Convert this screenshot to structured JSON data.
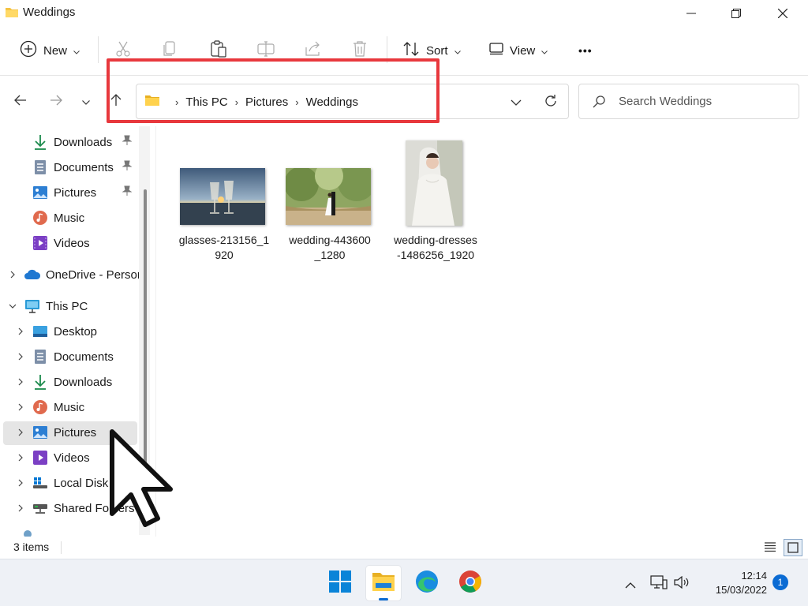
{
  "window": {
    "title": "Weddings"
  },
  "toolbar": {
    "new_label": "New",
    "sort_label": "Sort",
    "view_label": "View",
    "more_label": "•••"
  },
  "address": {
    "crumbs": [
      "This PC",
      "Pictures",
      "Weddings"
    ]
  },
  "search": {
    "placeholder": "Search Weddings"
  },
  "sidebar": {
    "quick_access": [
      {
        "label": "Downloads",
        "icon": "download-icon",
        "pinned": true
      },
      {
        "label": "Documents",
        "icon": "document-icon",
        "pinned": true
      },
      {
        "label": "Pictures",
        "icon": "picture-icon",
        "pinned": true
      },
      {
        "label": "Music",
        "icon": "music-icon",
        "pinned": false
      },
      {
        "label": "Videos",
        "icon": "video-icon",
        "pinned": false
      }
    ],
    "onedrive": "OneDrive - Person",
    "this_pc": "This PC",
    "pc_items": [
      {
        "label": "Desktop",
        "icon": "desktop-icon"
      },
      {
        "label": "Documents",
        "icon": "document-icon"
      },
      {
        "label": "Downloads",
        "icon": "download-icon"
      },
      {
        "label": "Music",
        "icon": "music-icon"
      },
      {
        "label": "Pictures",
        "icon": "picture-icon",
        "selected": true
      },
      {
        "label": "Videos",
        "icon": "video-icon"
      },
      {
        "label": "Local Disk (",
        "icon": "disk-icon"
      },
      {
        "label": "Shared Folders (",
        "icon": "network-drive-icon"
      }
    ]
  },
  "files": [
    {
      "name_line1": "glasses-213156_1",
      "name_line2": "920"
    },
    {
      "name_line1": "wedding-443600",
      "name_line2": "_1280"
    },
    {
      "name_line1": "wedding-dresses",
      "name_line2": "-1486256_1920"
    }
  ],
  "status": {
    "item_count": "3 items"
  },
  "taskbar": {
    "time": "12:14",
    "date": "15/03/2022",
    "notification_count": "1"
  },
  "colors": {
    "accent": "#0b6bd3",
    "highlight": "#e8383d",
    "folder": "#f5c342"
  }
}
